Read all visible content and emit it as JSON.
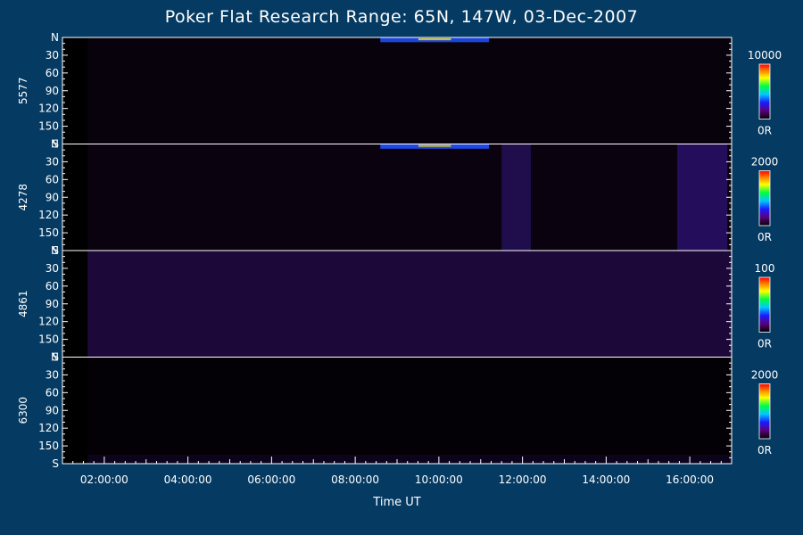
{
  "chart_data": {
    "type": "heatmap",
    "title": "Poker Flat Research Range: 65N, 147W, 03-Dec-2007",
    "xlabel": "Time UT",
    "x_ticks": [
      "02:00:00",
      "04:00:00",
      "06:00:00",
      "08:00:00",
      "10:00:00",
      "12:00:00",
      "14:00:00",
      "16:00:00"
    ],
    "x_range_hours": [
      1.0,
      17.0
    ],
    "y_ticks": [
      "N",
      "30",
      "60",
      "90",
      "120",
      "150",
      "S"
    ],
    "y_range_deg": [
      0,
      180
    ],
    "panels": [
      {
        "name": "5577",
        "cbar_max": "10000",
        "cbar_min": "0R",
        "features": [
          {
            "t0": 8.6,
            "t1": 11.2,
            "lat0": 0,
            "lat1": 8,
            "intensity": 0.75
          }
        ],
        "background": 0.05
      },
      {
        "name": "4278",
        "cbar_max": "2000",
        "cbar_min": "0R",
        "features": [
          {
            "t0": 8.6,
            "t1": 11.2,
            "lat0": 0,
            "lat1": 8,
            "intensity": 0.8
          },
          {
            "t0": 11.5,
            "t1": 12.2,
            "lat0": 0,
            "lat1": 180,
            "intensity": 0.35
          },
          {
            "t0": 15.7,
            "t1": 16.9,
            "lat0": 0,
            "lat1": 180,
            "intensity": 0.45
          }
        ],
        "background": 0.06
      },
      {
        "name": "4861",
        "cbar_max": "100",
        "cbar_min": "0R",
        "features": [
          {
            "t0": 1.6,
            "t1": 17.0,
            "lat0": 0,
            "lat1": 180,
            "intensity": 0.25
          }
        ],
        "background": 0.12
      },
      {
        "name": "6300",
        "cbar_max": "2000",
        "cbar_min": "0R",
        "features": [
          {
            "t0": 1.6,
            "t1": 17.0,
            "lat0": 165,
            "lat1": 180,
            "intensity": 0.12
          }
        ],
        "background": 0.02
      }
    ]
  }
}
